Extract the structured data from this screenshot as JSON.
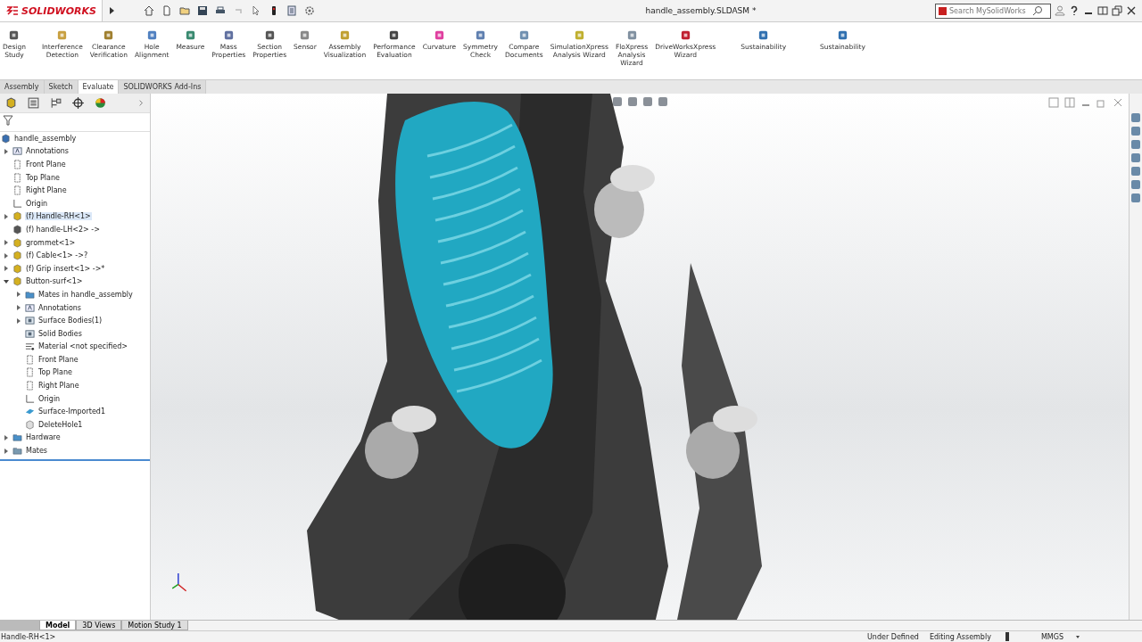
{
  "app": {
    "logo": "SOLIDWORKS"
  },
  "window": {
    "title": "handle_assembly.SLDASM *"
  },
  "search": {
    "placeholder": "Search MySolidWorks"
  },
  "ribbon": {
    "buttons": [
      {
        "lines": [
          "Design",
          "Study"
        ]
      },
      {
        "lines": [
          "Interference",
          "Detection"
        ]
      },
      {
        "lines": [
          "Clearance",
          "Verification"
        ]
      },
      {
        "lines": [
          "Hole",
          "Alignment"
        ]
      },
      {
        "lines": [
          "Measure"
        ]
      },
      {
        "lines": [
          "Mass",
          "Properties"
        ]
      },
      {
        "lines": [
          "Section",
          "Properties"
        ]
      },
      {
        "lines": [
          "Sensor"
        ]
      },
      {
        "lines": [
          "Assembly",
          "Visualization"
        ]
      },
      {
        "lines": [
          "Performance",
          "Evaluation"
        ]
      },
      {
        "lines": [
          "Curvature"
        ]
      },
      {
        "lines": [
          "Symmetry",
          "Check"
        ]
      },
      {
        "lines": [
          "Compare",
          "Documents"
        ]
      },
      {
        "lines": [
          "SimulationXpress",
          "Analysis Wizard"
        ]
      },
      {
        "lines": [
          "FloXpress",
          "Analysis",
          "Wizard"
        ]
      },
      {
        "lines": [
          "DriveWorksXpress",
          "Wizard"
        ]
      },
      {
        "lines": [
          "Sustainability"
        ]
      },
      {
        "lines": [
          "Sustainability"
        ]
      }
    ]
  },
  "tabs": [
    {
      "label": "Assembly",
      "selected": false
    },
    {
      "label": "Sketch",
      "selected": false
    },
    {
      "label": "Evaluate",
      "selected": true
    },
    {
      "label": "SOLIDWORKS Add-Ins",
      "selected": false
    }
  ],
  "tree": {
    "root": {
      "label": "handle_assembly",
      "kind": "assembly",
      "children": [
        {
          "label": "Annotations",
          "kind": "annotations",
          "expanded": false
        },
        {
          "label": "Front Plane",
          "kind": "plane"
        },
        {
          "label": "Top Plane",
          "kind": "plane"
        },
        {
          "label": "Right Plane",
          "kind": "plane"
        },
        {
          "label": "Origin",
          "kind": "origin"
        },
        {
          "label": "(f) Handle-RH<1>",
          "kind": "part",
          "expanded": false,
          "selected": true
        },
        {
          "label": "(f) handle-LH<2> ->",
          "kind": "subassembly"
        },
        {
          "label": "grommet<1>",
          "kind": "part",
          "expanded": false
        },
        {
          "label": "(f) Cable<1> ->?",
          "kind": "part",
          "expanded": false
        },
        {
          "label": "(f) Grip insert<1> ->*",
          "kind": "part",
          "expanded": false
        },
        {
          "label": "Button-surf<1>",
          "kind": "part",
          "expanded": true,
          "children": [
            {
              "label": "Mates in handle_assembly",
              "kind": "folder",
              "expanded": false
            },
            {
              "label": "Annotations",
              "kind": "annotations",
              "expanded": false
            },
            {
              "label": "Surface Bodies(1)",
              "kind": "bodies",
              "expanded": false
            },
            {
              "label": "Solid Bodies",
              "kind": "bodies"
            },
            {
              "label": "Material <not specified>",
              "kind": "material"
            },
            {
              "label": "Front Plane",
              "kind": "plane"
            },
            {
              "label": "Top Plane",
              "kind": "plane"
            },
            {
              "label": "Right Plane",
              "kind": "plane"
            },
            {
              "label": "Origin",
              "kind": "origin"
            },
            {
              "label": "Surface-Imported1",
              "kind": "surface"
            },
            {
              "label": "DeleteHole1",
              "kind": "feature"
            }
          ]
        },
        {
          "label": "Hardware",
          "kind": "folder",
          "expanded": false
        },
        {
          "label": "Mates",
          "kind": "mates",
          "expanded": false
        }
      ]
    }
  },
  "bottom_tabs": [
    {
      "label": "Model",
      "selected": true
    },
    {
      "label": "3D Views",
      "selected": false
    },
    {
      "label": "Motion Study 1",
      "selected": false
    }
  ],
  "status_bar": {
    "selection": "Handle-RH<1>",
    "state": "Under Defined",
    "mode": "Editing Assembly",
    "units": "MMGS"
  }
}
